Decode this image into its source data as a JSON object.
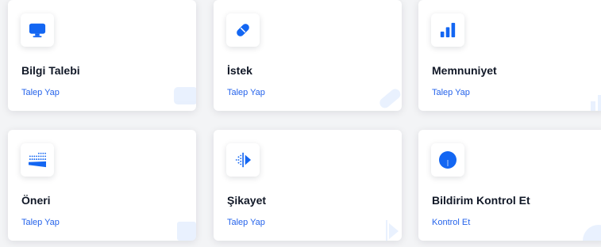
{
  "colors": {
    "accent": "#1366f2",
    "link": "#2563eb",
    "title": "#111827"
  },
  "cards": [
    {
      "title": "Bilgi Talebi",
      "link": "Talep Yap",
      "icon": "monitor-icon"
    },
    {
      "title": "İstek",
      "link": "Talep Yap",
      "icon": "pill-icon"
    },
    {
      "title": "Memnuniyet",
      "link": "Talep Yap",
      "icon": "signal-bars-icon"
    },
    {
      "title": "Öneri",
      "link": "Talep Yap",
      "icon": "sprinkle-icon"
    },
    {
      "title": "Şikayet",
      "link": "Talep Yap",
      "icon": "split-arrow-icon"
    },
    {
      "title": "Bildirim Kontrol Et",
      "link": "Kontrol Et",
      "icon": "circle-icon"
    }
  ]
}
